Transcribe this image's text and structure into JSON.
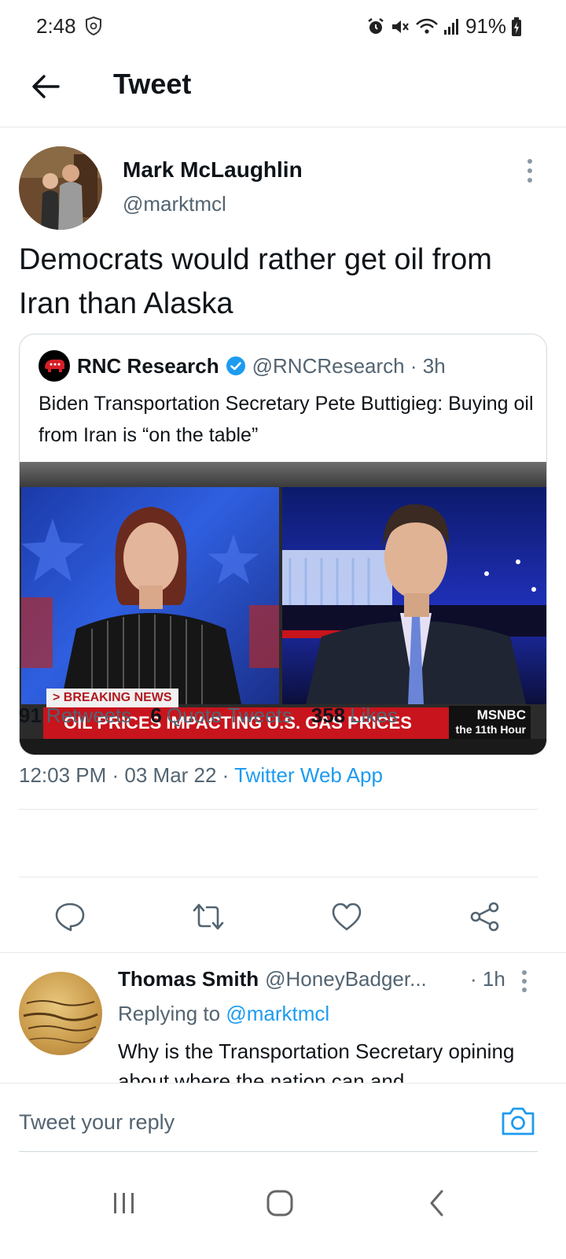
{
  "status_bar": {
    "time": "2:48",
    "battery": "91%",
    "icons": [
      "shield-icon",
      "alarm-icon",
      "mute-icon",
      "wifi-icon",
      "signal-icon",
      "battery-charging-icon"
    ]
  },
  "header": {
    "title": "Tweet",
    "back_icon": "arrow-left-icon"
  },
  "tweet": {
    "author_name": "Mark McLaughlin",
    "author_handle": "@marktmcl",
    "text": "Democrats would rather get oil from Iran than Alaska",
    "quote": {
      "name": "RNC Research",
      "handle_time": "@RNCResearch · 3h",
      "text": "Biden Transportation Secretary Pete Buttigieg: Buying oil from Iran is “on the table”",
      "media": {
        "breaking_label": "> BREAKING NEWS",
        "headline": "OIL PRICES IMPACTING U.S. GAS PRICES",
        "network": "MSNBC",
        "show": "the 11th Hour"
      }
    },
    "timestamp": "12:03 PM · 03 Mar 22 · ",
    "source": "Twitter Web App",
    "stats": {
      "retweets_count": "91",
      "retweets_label": "Retweets",
      "quotes_count": "6",
      "quotes_label": "Quote Tweets",
      "likes_count": "358",
      "likes_label": "Likes"
    }
  },
  "reply": {
    "name": "Thomas Smith",
    "handle": "@HoneyBadger...",
    "time": "· 1h",
    "replying_prefix": "Replying to ",
    "replying_to": "@marktmcl",
    "text": "Why is the Transportation Secretary opining about where the nation can and"
  },
  "composer": {
    "placeholder": "Tweet your reply"
  },
  "colors": {
    "accent": "#1d9bf0",
    "text_primary": "#0f1419",
    "text_secondary": "#536471",
    "breaking_red": "#c8141c"
  }
}
